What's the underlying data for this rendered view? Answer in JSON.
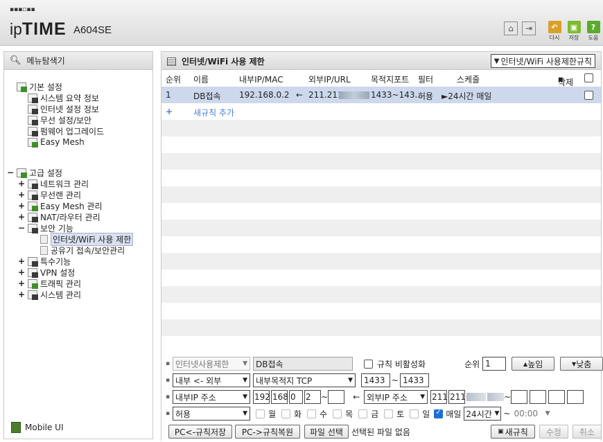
{
  "header": {
    "logo_main": "ipTIME",
    "model": "A604SE",
    "icons": [
      "home-icon",
      "logout-icon"
    ],
    "buttons": [
      {
        "label": "다시",
        "color": "#d9a027",
        "icon": "undo-icon"
      },
      {
        "label": "저장",
        "color": "#7dbb2f",
        "icon": "save-icon"
      },
      {
        "label": "도움",
        "color": "#5aab2b",
        "icon": "help-icon"
      }
    ]
  },
  "sidebar": {
    "title": "메뉴탐색기",
    "basic": {
      "label": "기본 설정",
      "items": [
        "시스템 요약 정보",
        "인터넷 설정 정보",
        "무선 설정/보안",
        "펌웨어 업그레이드",
        "Easy Mesh"
      ]
    },
    "advanced": {
      "label": "고급 설정",
      "items": [
        "네트워크 관리",
        "무선랜 관리",
        "Easy Mesh 관리",
        "NAT/라우터 관리",
        "보안 기능"
      ],
      "security_children": [
        "인터넷/WiFi 사용 제한",
        "공유기 접속/보안관리"
      ],
      "items_after": [
        "특수기능",
        "VPN 설정",
        "트래픽 관리",
        "시스템 관리"
      ]
    },
    "mobile_label": "Mobile UI"
  },
  "main": {
    "title": "인터넷/WiFi 사용 제한",
    "rule_select": "인터넷/WiFi 사용제한규칙",
    "columns": {
      "order": "순위",
      "name": "이름",
      "internal": "내부IP/MAC",
      "external": "외부IP/URL",
      "dest_port": "목적지포트",
      "filter": "필터",
      "schedule": "스케줄",
      "delete": "삭제"
    },
    "rows": [
      {
        "order": "1",
        "name": "DB접속",
        "internal": "192.168.0.2",
        "arrow": "←",
        "external": "211.211",
        "dest_port": "1433~143...",
        "filter": "허용",
        "schedule": "►24시간 매일"
      }
    ],
    "add_rule": "새규칙 추가",
    "add_symbol": "+"
  },
  "form": {
    "type_select": "인터넷사용제한",
    "rule_name": "DB접속",
    "disable_label": "규칙 비활성화",
    "order_label": "순위",
    "order_value": "1",
    "up_label": "높임",
    "down_label": "낮춤",
    "direction_select": "내부 <- 외부",
    "port_type_select": "내부목적지 TCP",
    "port_from": "1433",
    "port_to": "1433",
    "internal_addr_select": "내부IP 주소",
    "ip": [
      "192",
      "168",
      "0",
      "2"
    ],
    "external_addr_select": "외부IP 주소",
    "ext_ip": [
      "211",
      "211"
    ],
    "filter_select": "허용",
    "days": [
      "월",
      "화",
      "수",
      "목",
      "금",
      "토",
      "일"
    ],
    "everyday_label": "매일",
    "hours_select": "24시간",
    "time_select": "00:00",
    "btn_save_pc": "PC<-규칙저장",
    "btn_restore_pc": "PC->규칙복원",
    "btn_file": "파일 선택",
    "file_status": "선택된 파일 없음",
    "btn_new": "새규칙",
    "btn_modify": "수정",
    "btn_cancel": "취소",
    "tilde": "~"
  }
}
